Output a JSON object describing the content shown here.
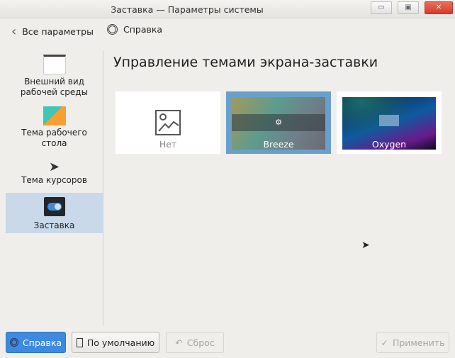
{
  "window": {
    "title": "Заставка  — Параметры системы",
    "minimize": "▭",
    "maximize": "▣",
    "close": "✕"
  },
  "toolbar": {
    "back_label": "Все параметры",
    "help_label": "Справка"
  },
  "sidebar": {
    "items": [
      {
        "label": "Внешний вид рабочей среды"
      },
      {
        "label": "Тема рабочего стола"
      },
      {
        "label": "Тема курсоров"
      },
      {
        "label": "Заставка",
        "selected": true
      }
    ]
  },
  "main": {
    "heading": "Управление темами экрана-заставки",
    "themes": [
      {
        "label": "Нет"
      },
      {
        "label": "Breeze",
        "selected": true
      },
      {
        "label": "Oxygen"
      }
    ]
  },
  "footer": {
    "help": "Справка",
    "defaults": "По умолчанию",
    "reset": "Сброс",
    "apply": "Применить"
  },
  "colors": {
    "accent": "#3d8ae0",
    "selection": "#c9d9ea",
    "tile_selected": "#6a9fcc"
  }
}
